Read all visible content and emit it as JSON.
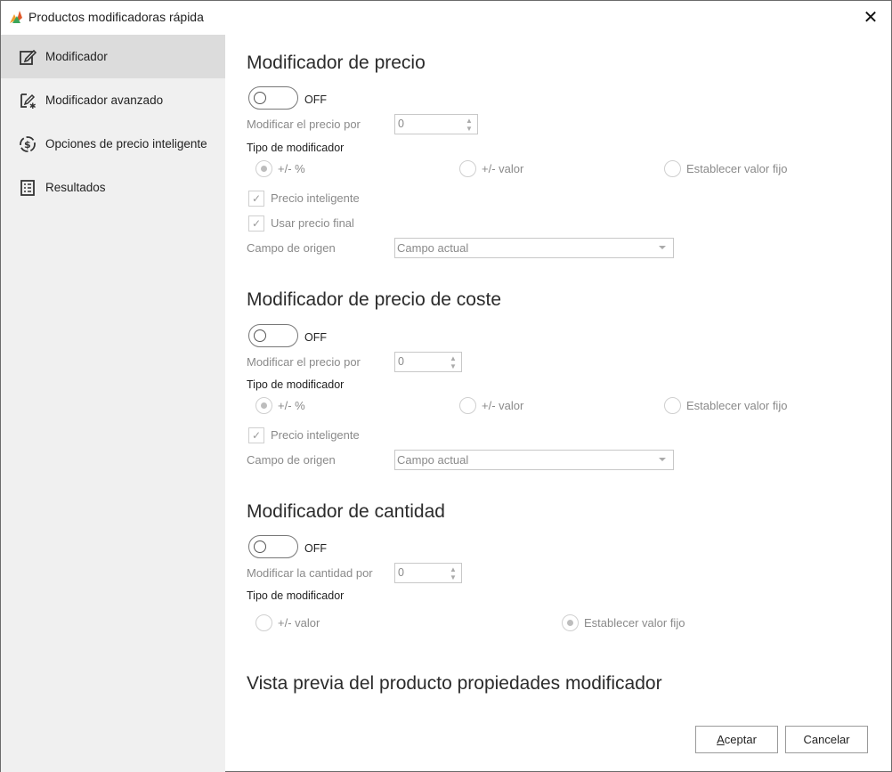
{
  "window": {
    "title": "Productos modificadoras rápida"
  },
  "sidebar": {
    "items": [
      {
        "label": "Modificador",
        "icon": "edit-icon"
      },
      {
        "label": "Modificador avanzado",
        "icon": "advanced-edit-icon"
      },
      {
        "label": "Opciones de precio inteligente",
        "icon": "smart-price-icon"
      },
      {
        "label": "Resultados",
        "icon": "results-icon"
      }
    ]
  },
  "price": {
    "title": "Modificador de precio",
    "toggle": "OFF",
    "modify_label": "Modificar el precio por",
    "modify_value": "0",
    "type_label": "Tipo de modificador",
    "radios": [
      "+/- %",
      "+/- valor",
      "Establecer valor fijo"
    ],
    "smart_price": "Precio inteligente",
    "final_price": "Usar precio final",
    "source_label": "Campo de origen",
    "source_value": "Campo actual"
  },
  "cost": {
    "title": "Modificador de precio de coste",
    "toggle": "OFF",
    "modify_label": "Modificar el precio por",
    "modify_value": "0",
    "type_label": "Tipo de modificador",
    "radios": [
      "+/- %",
      "+/- valor",
      "Establecer valor fijo"
    ],
    "smart_price": "Precio inteligente",
    "source_label": "Campo de origen",
    "source_value": "Campo actual"
  },
  "quantity": {
    "title": "Modificador de cantidad",
    "toggle": "OFF",
    "modify_label": "Modificar la cantidad por",
    "modify_value": "0",
    "type_label": "Tipo de modificador",
    "radios": [
      "+/- valor",
      "Establecer valor fijo"
    ]
  },
  "preview": {
    "title": "Vista previa del producto propiedades modificador"
  },
  "buttons": {
    "accept_hotkey": "A",
    "accept_rest": "ceptar",
    "cancel": "Cancelar"
  }
}
